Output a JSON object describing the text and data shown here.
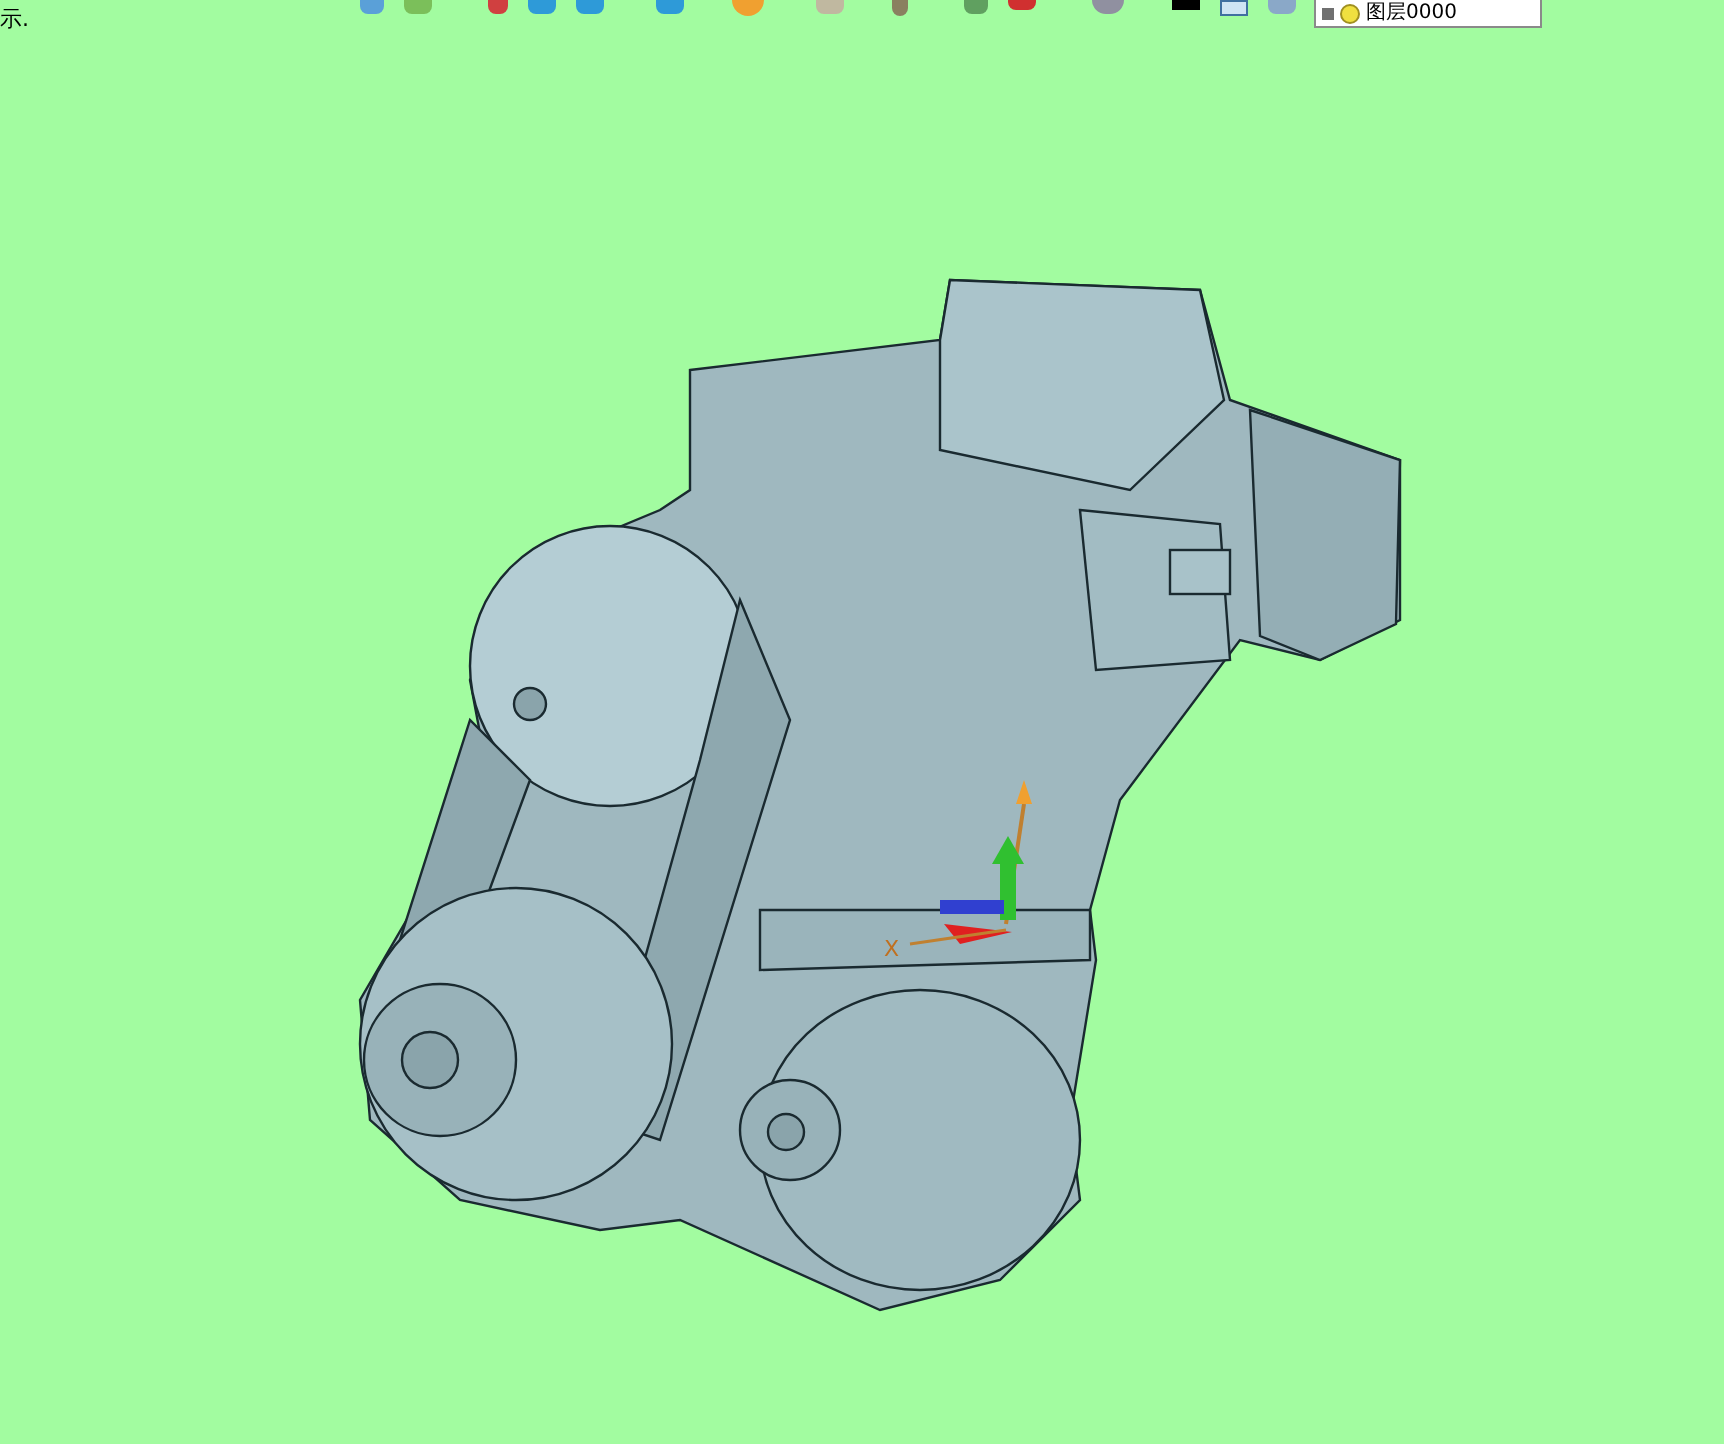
{
  "viewport": {
    "corner_text": "示.",
    "axis_label": "X"
  },
  "toolbar": {
    "layer_dropdown": {
      "value": "图层0000"
    }
  }
}
